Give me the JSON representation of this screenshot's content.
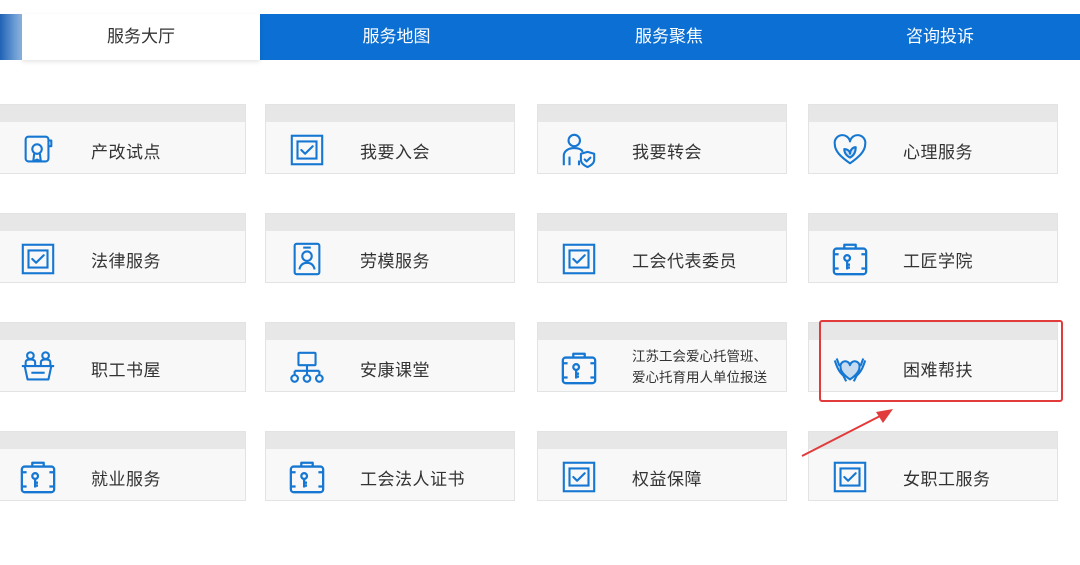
{
  "tabs": [
    {
      "label": "服务大厅",
      "active": true
    },
    {
      "label": "服务地图",
      "active": false
    },
    {
      "label": "服务聚焦",
      "active": false
    },
    {
      "label": "咨询投诉",
      "active": false
    }
  ],
  "cards": [
    {
      "label": "产改试点",
      "icon": "certificate-icon"
    },
    {
      "label": "我要入会",
      "icon": "checkbox-frame-icon"
    },
    {
      "label": "我要转会",
      "icon": "user-shield-icon"
    },
    {
      "label": "心理服务",
      "icon": "heart-leaf-icon"
    },
    {
      "label": "法律服务",
      "icon": "checkbox-frame-icon"
    },
    {
      "label": "劳模服务",
      "icon": "id-badge-icon"
    },
    {
      "label": "工会代表委员",
      "icon": "checkbox-frame-icon"
    },
    {
      "label": "工匠学院",
      "icon": "briefcase-key-icon"
    },
    {
      "label": "职工书屋",
      "icon": "reading-people-icon"
    },
    {
      "label": "安康课堂",
      "icon": "network-icon"
    },
    {
      "label": "江苏工会爱心托管班、爱心托育用人单位报送",
      "icon": "briefcase-key-icon"
    },
    {
      "label": "困难帮扶",
      "icon": "hands-heart-icon"
    },
    {
      "label": "就业服务",
      "icon": "briefcase-key-icon"
    },
    {
      "label": "工会法人证书",
      "icon": "briefcase-key-icon"
    },
    {
      "label": "权益保障",
      "icon": "checkbox-frame-icon"
    },
    {
      "label": "女职工服务",
      "icon": "checkbox-frame-icon"
    }
  ],
  "colors": {
    "tab_bar": "#0b6fd3",
    "icon_blue": "#1677d2",
    "highlight_red": "#e23b3b"
  },
  "highlighted_card": "困难帮扶"
}
